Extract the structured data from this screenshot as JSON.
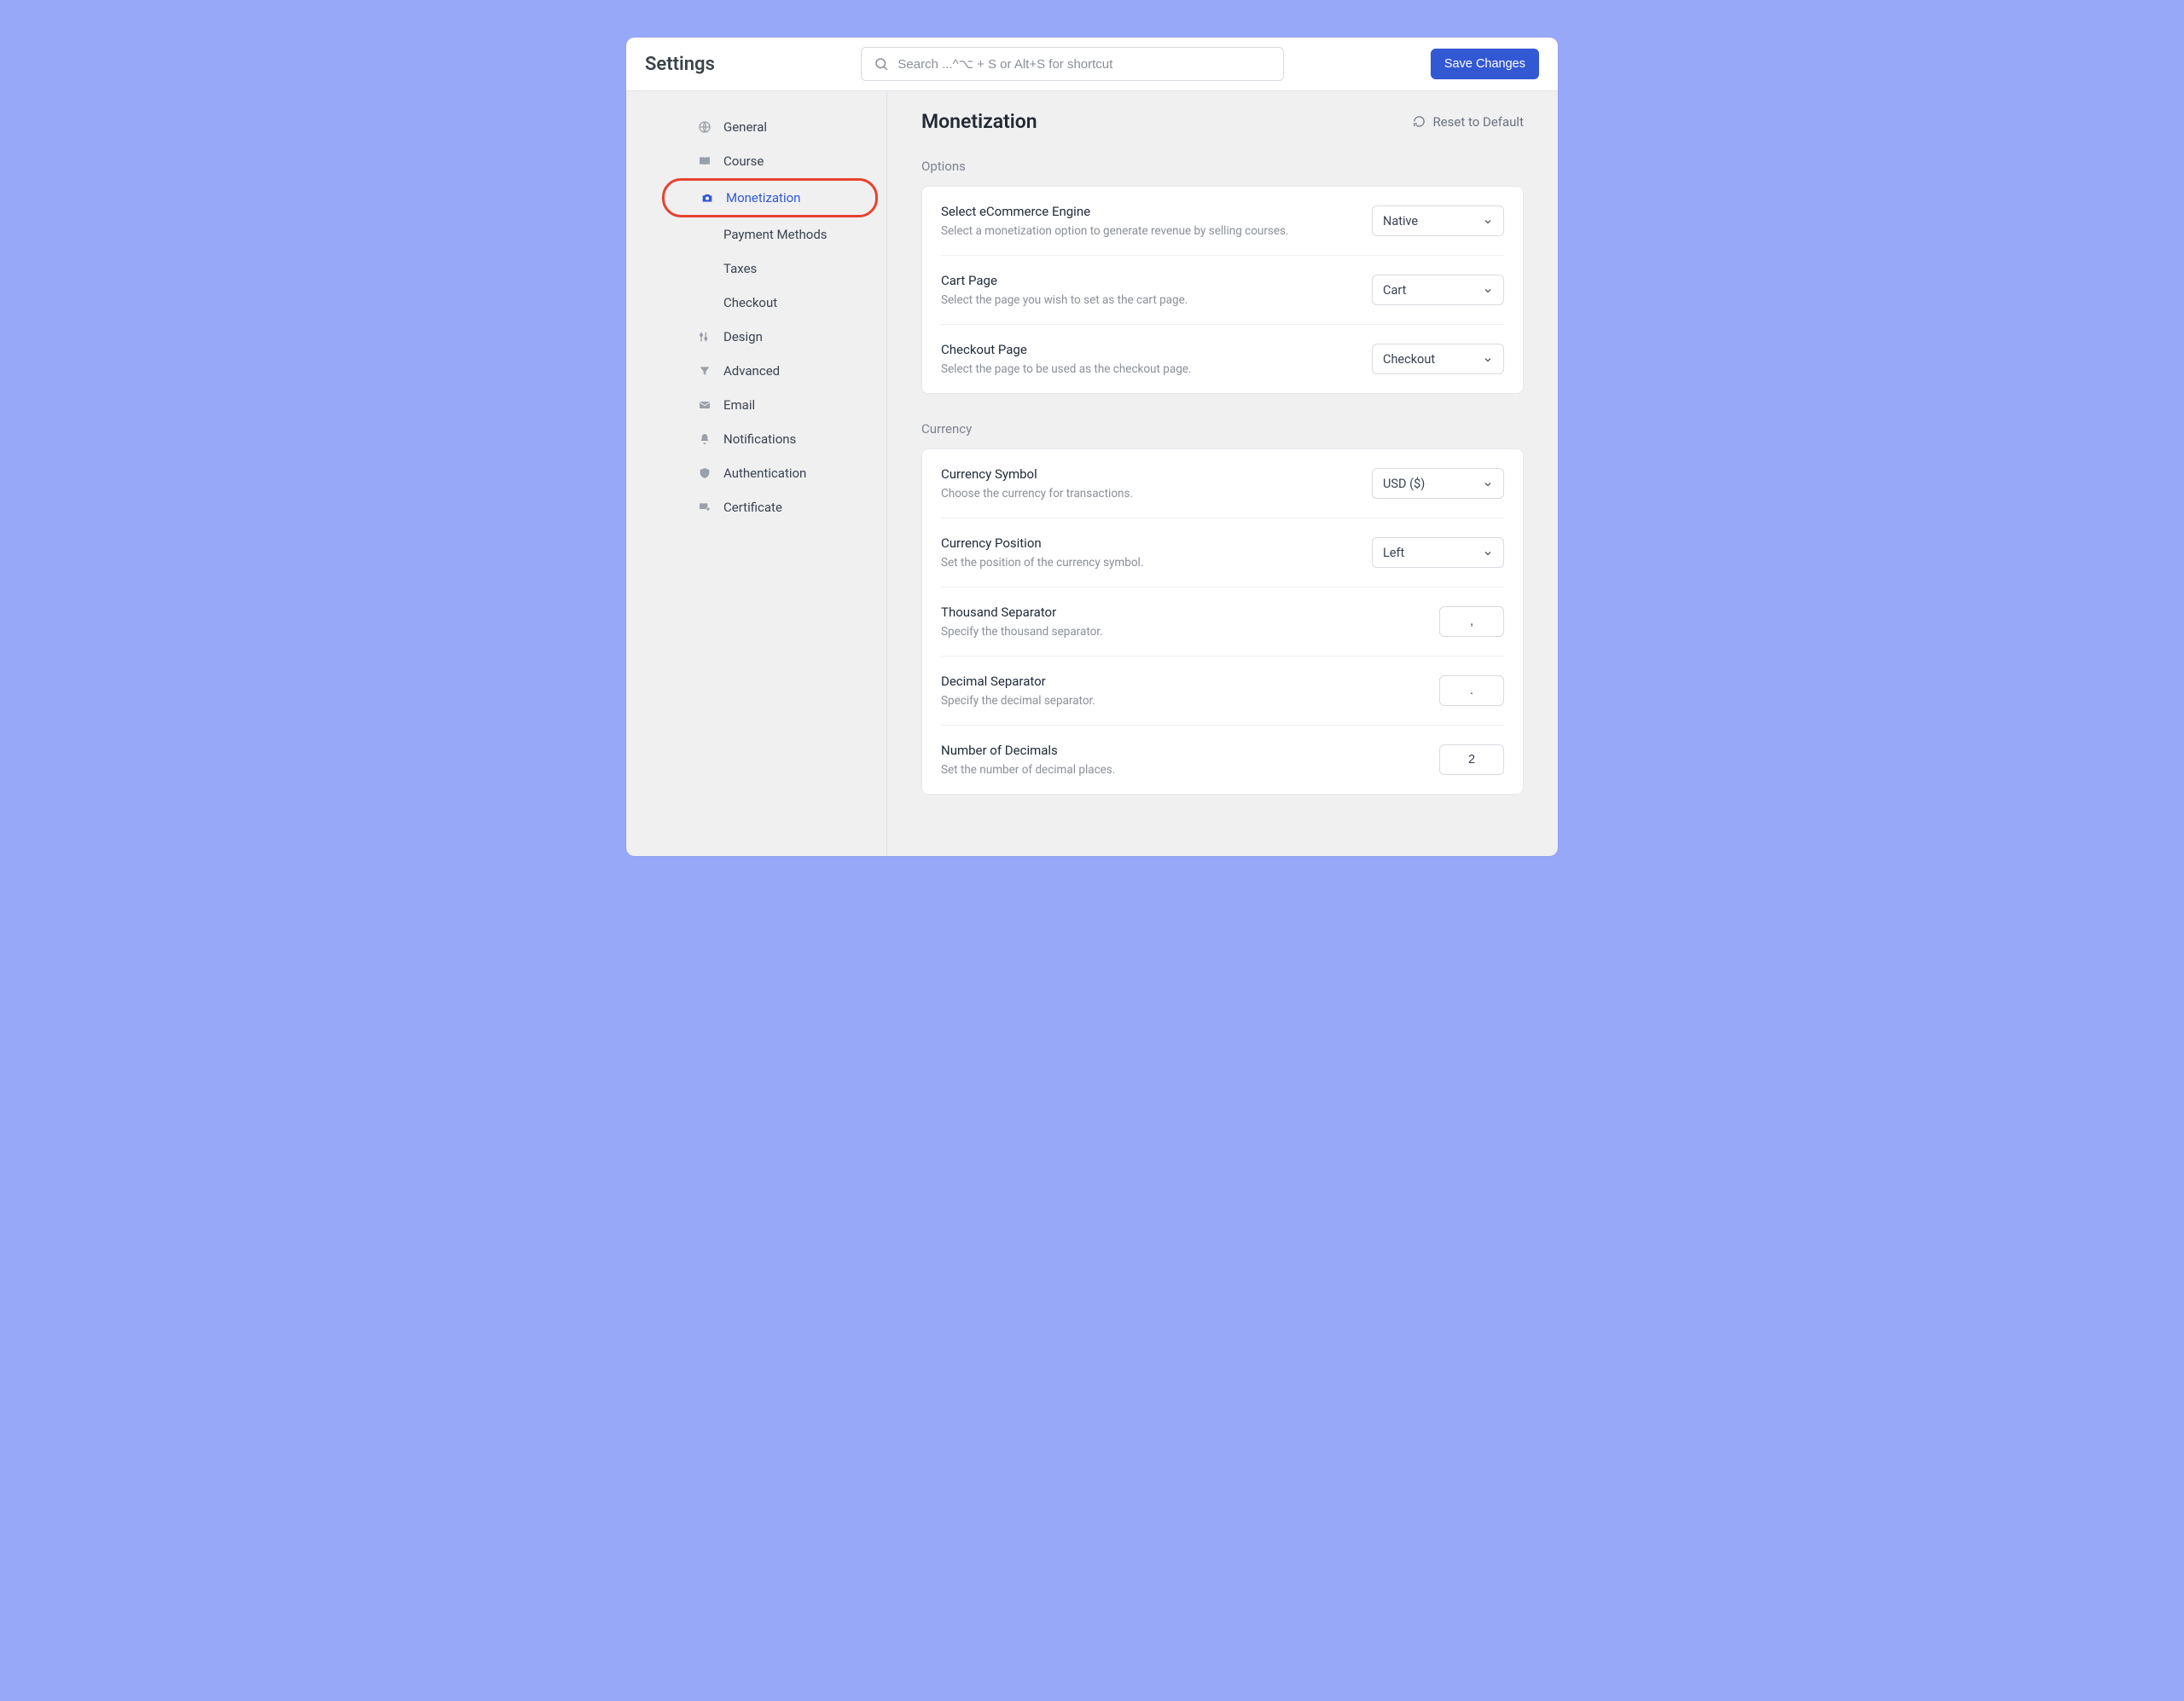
{
  "topbar": {
    "title": "Settings",
    "search_placeholder": "Search ...^⌥ + S or Alt+S for shortcut",
    "save_label": "Save Changes"
  },
  "sidebar": {
    "general": "General",
    "course": "Course",
    "monetization": "Monetization",
    "sub_payment": "Payment Methods",
    "sub_taxes": "Taxes",
    "sub_checkout": "Checkout",
    "design": "Design",
    "advanced": "Advanced",
    "email": "Email",
    "notifications": "Notifications",
    "authentication": "Authentication",
    "certificate": "Certificate"
  },
  "main": {
    "title": "Monetization",
    "reset": "Reset to Default"
  },
  "sections": {
    "options_label": "Options",
    "currency_label": "Currency"
  },
  "options": {
    "engine": {
      "title": "Select eCommerce Engine",
      "desc": "Select a monetization option to generate revenue by selling courses.",
      "value": "Native"
    },
    "cart": {
      "title": "Cart Page",
      "desc": "Select the page you wish to set as the cart page.",
      "value": "Cart"
    },
    "checkout": {
      "title": "Checkout Page",
      "desc": "Select the page to be used as the checkout page.",
      "value": "Checkout"
    }
  },
  "currency": {
    "symbol": {
      "title": "Currency Symbol",
      "desc": "Choose the currency for transactions.",
      "value": "USD ($)"
    },
    "position": {
      "title": "Currency Position",
      "desc": "Set the position of the currency symbol.",
      "value": "Left"
    },
    "thousand": {
      "title": "Thousand Separator",
      "desc": "Specify the thousand separator.",
      "value": ","
    },
    "decimal": {
      "title": "Decimal Separator",
      "desc": "Specify the decimal separator.",
      "value": "."
    },
    "decimals": {
      "title": "Number of Decimals",
      "desc": "Set the number of decimal places.",
      "value": "2"
    }
  }
}
